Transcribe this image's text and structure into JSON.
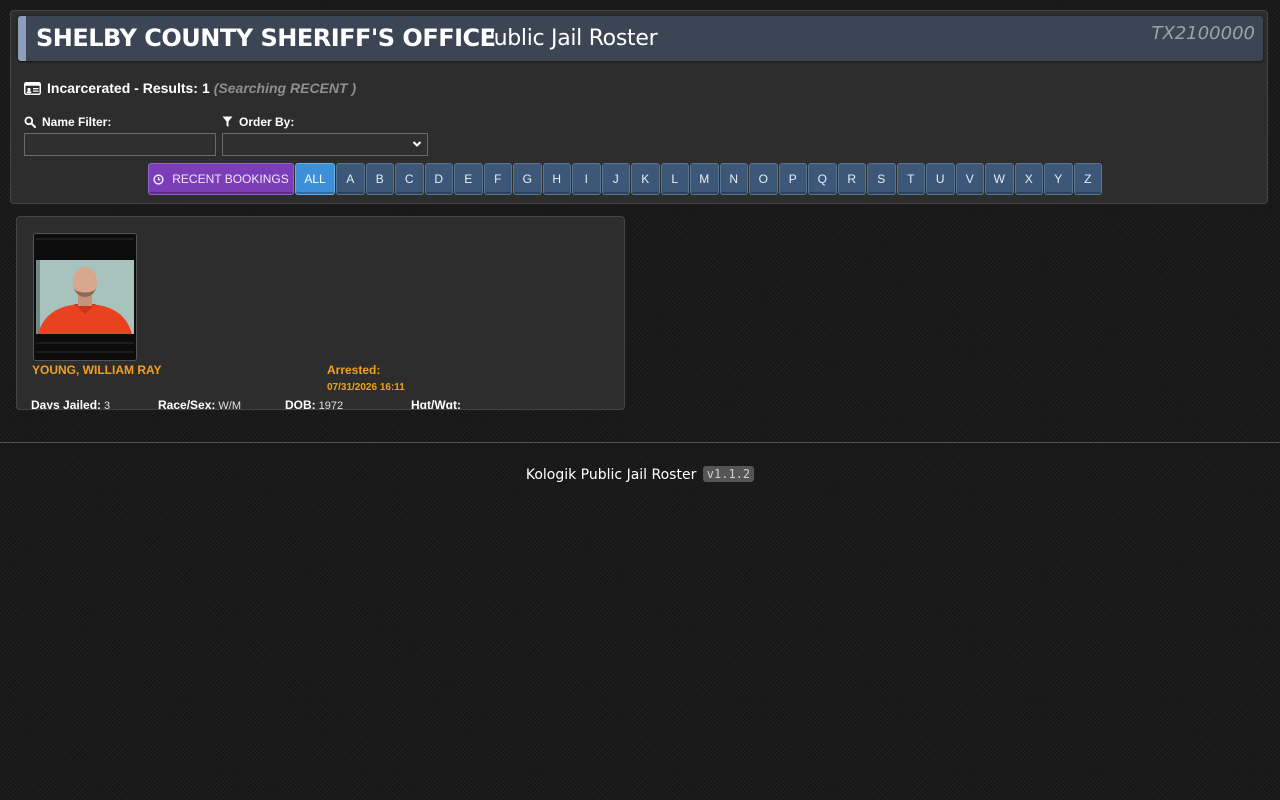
{
  "header": {
    "title": "SHELBY COUNTY SHERIFF'S OFFICE",
    "subtitle": "Public Jail Roster",
    "code": "TX2100000"
  },
  "results": {
    "icon": "id-card-icon",
    "label": "Incarcerated - Results:",
    "count": "1",
    "searching": "(Searching RECENT )"
  },
  "filters": {
    "name_label": "Name Filter:",
    "name_icon": "search-icon",
    "name_value": "",
    "order_label": "Order By:",
    "order_icon": "filter-icon",
    "order_value": ""
  },
  "buttons": {
    "recent": "RECENT BOOKINGS",
    "recent_icon": "clock-icon",
    "all": "ALL",
    "letters": [
      "A",
      "B",
      "C",
      "D",
      "E",
      "F",
      "G",
      "H",
      "I",
      "J",
      "K",
      "L",
      "M",
      "N",
      "O",
      "P",
      "Q",
      "R",
      "S",
      "T",
      "U",
      "V",
      "W",
      "X",
      "Y",
      "Z"
    ]
  },
  "inmate": {
    "name": "YOUNG, WILLIAM RAY",
    "arrested_label": "Arrested:",
    "arrested_date": "07/31/2026 16:11",
    "days_jailed_label": "Days Jailed:",
    "days_jailed": "3",
    "race_sex_label": "Race/Sex:",
    "race_sex": "W/M",
    "dob_label": "DOB:",
    "dob": "1972",
    "hgt_wgt_label": "Hgt/Wgt:",
    "hgt_wgt": ""
  },
  "footer": {
    "text": "Kologik Public Jail Roster",
    "version": "v1.1.2"
  },
  "colors": {
    "accent_orange": "#f0a020",
    "recent_button": "#7b3db8",
    "all_button": "#3d8fd8",
    "letter_button": "#3c5778"
  }
}
